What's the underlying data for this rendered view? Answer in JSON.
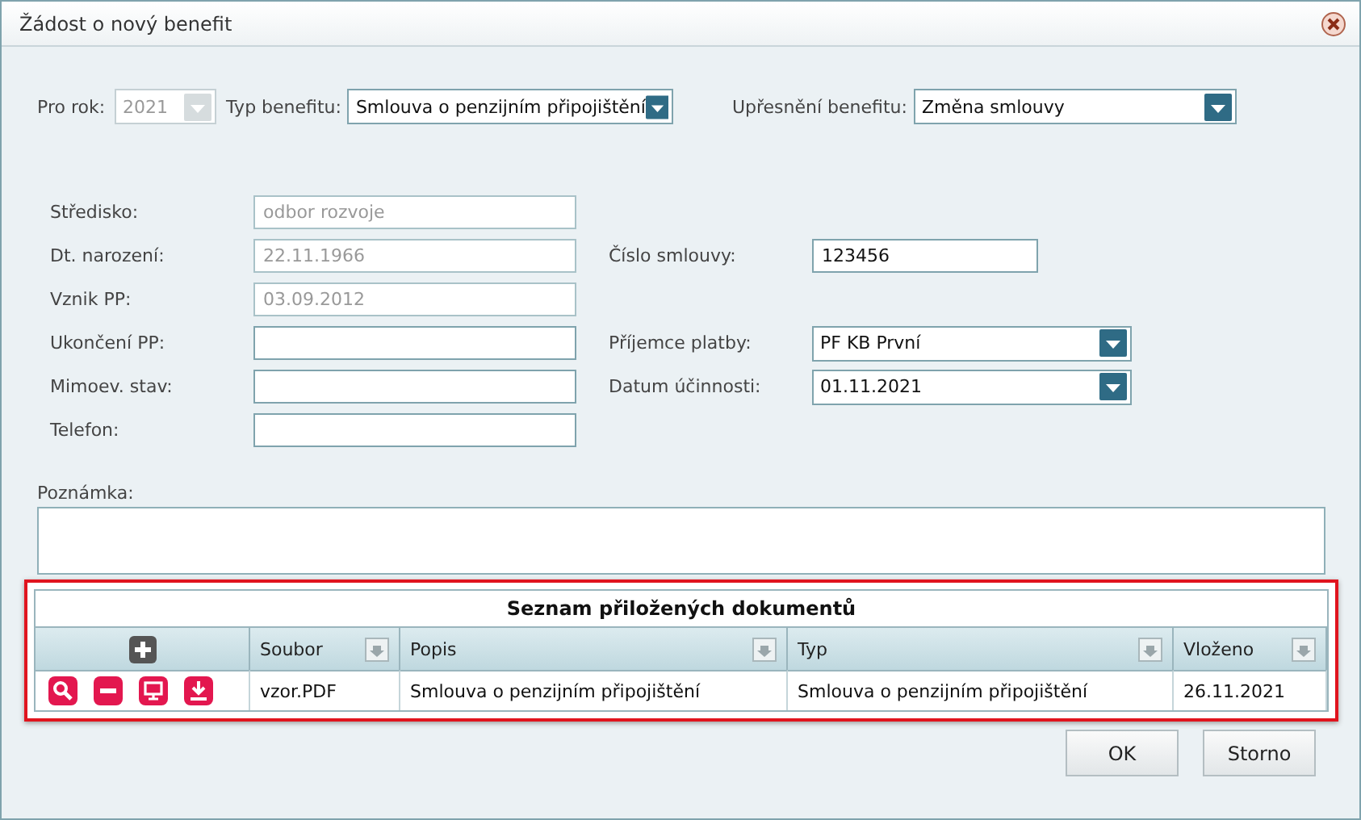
{
  "window": {
    "title": "Žádost o nový benefit"
  },
  "top": {
    "year": {
      "label": "Pro rok:",
      "value": "2021",
      "disabled": true
    },
    "type": {
      "label": "Typ benefitu:",
      "value": "Smlouva o penzijním připojištění",
      "disabled": false
    },
    "detail": {
      "label": "Upřesnění benefitu:",
      "value": "Změna smlouvy",
      "disabled": false
    }
  },
  "left_fields": [
    {
      "label": "Středisko:",
      "value": "odbor rozvoje",
      "disabled": true
    },
    {
      "label": "Dt. narození:",
      "value": "22.11.1966",
      "disabled": true
    },
    {
      "label": "Vznik PP:",
      "value": "03.09.2012",
      "disabled": true
    },
    {
      "label": "Ukončení PP:",
      "disabled": false
    },
    {
      "label": "Mimoev. stav:",
      "disabled": false
    },
    {
      "label": "Telefon:",
      "disabled": false
    }
  ],
  "right_fields": [
    {
      "kind": "text",
      "label": "Číslo smlouvy:",
      "value": "123456"
    },
    {
      "kind": "select",
      "label": "Příjemce platby:",
      "value": "PF KB První"
    },
    {
      "kind": "select",
      "label": "Datum účinnosti:",
      "value": "01.11.2021"
    }
  ],
  "note": {
    "label": "Poznámka:"
  },
  "documents": {
    "title": "Seznam přiložených dokumentů",
    "columns": [
      "Soubor",
      "Popis",
      "Typ",
      "Vloženo"
    ],
    "rows": [
      {
        "cells": [
          "vzor.PDF",
          "Smlouva o penzijním připojištění",
          "Smlouva o penzijním připojištění",
          "26.11.2021"
        ]
      }
    ]
  },
  "buttons": [
    "OK",
    "Storno"
  ]
}
